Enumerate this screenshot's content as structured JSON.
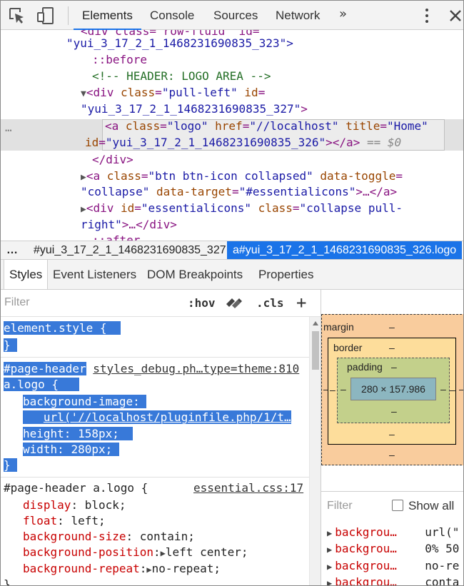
{
  "toolbar": {
    "tabs": [
      {
        "label": "Elements"
      },
      {
        "label": "Console"
      },
      {
        "label": "Sources"
      },
      {
        "label": "Network"
      }
    ],
    "more_label": "»",
    "icons": [
      "inspect-cursor-icon",
      "device-toggle-icon",
      "kebab-menu-icon",
      "close-icon"
    ]
  },
  "dom": {
    "lines": [
      {
        "t1": "<div class=\"row-fluid\" id="
      },
      {
        "t1": "\"yui_3_17_2_1_1468231690835_323\">"
      },
      {
        "t1": "::before"
      },
      {
        "t1": "<!-- HEADER: LOGO AREA -->"
      },
      {
        "tag": "<div",
        "an1": "class",
        "av1": "\"pull-left\"",
        "an2": "id",
        "eq": "="
      },
      {
        "t1": "\"yui_3_17_2_1_1468231690835_327\"",
        "close": ">"
      },
      {
        "tag": "<a",
        "an1": "class",
        "av1": "\"logo\"",
        "an2": "href",
        "av2": "\"//localhost\"",
        "an3": "title",
        "av3": "\"Home\""
      },
      {
        "an1": "id",
        "av1": "\"yui_3_17_2_1_1468231690835_326\"",
        "close": "></a>",
        "eq0": "== $0"
      },
      {
        "t1": "</div>"
      },
      {
        "tag": "<a",
        "an1": "class",
        "av1": "\"btn btn-icon collapsed\"",
        "an2": "data-toggle"
      },
      {
        "av1": "\"collapse\"",
        "an1": "data-target",
        "av2": "\"#essentialicons\"",
        "close": ">…</a>"
      },
      {
        "tag": "<div",
        "an1": "id",
        "av1": "\"essentialicons\"",
        "an2": "class",
        "av2": "\"collapse pull-"
      },
      {
        "av1": "right\"",
        "close": ">…</div>"
      },
      {
        "t1": "::after"
      }
    ],
    "ellipsis": "…"
  },
  "breadcrumbs": {
    "dots": "…",
    "items": [
      "#yui_3_17_2_1_1468231690835_327",
      "a#yui_3_17_2_1_1468231690835_326.logo"
    ]
  },
  "subtabs": [
    "Styles",
    "Event Listeners",
    "DOM Breakpoints",
    "Properties"
  ],
  "styles": {
    "filter_placeholder": "Filter",
    "hov": ":hov",
    "cls": ".cls",
    "plus": "+",
    "rule1": {
      "selector": "element.style {",
      "close": "}"
    },
    "rule2": {
      "selector1": "#page-header",
      "source": "styles_debug.ph…type=theme:810",
      "selector2": "a.logo {",
      "props": [
        {
          "name": "background-image",
          "value": ""
        },
        {
          "name": "",
          "value": "url('//localhost/pluginfile.php/1/t…"
        },
        {
          "name": "height",
          "value": "158px;"
        },
        {
          "name": "width",
          "value": "280px;"
        }
      ],
      "close": "}"
    },
    "rule3": {
      "selector": "#page-header a.logo {",
      "source": "essential.css:17",
      "props": [
        {
          "name": "display",
          "value": "block;"
        },
        {
          "name": "float",
          "value": "left;"
        },
        {
          "name": "background-size",
          "value": "contain;"
        },
        {
          "name": "background-position",
          "value": "left center;"
        },
        {
          "name": "background-repeat",
          "value": "no-repeat;"
        }
      ],
      "close": "}"
    }
  },
  "boxmodel": {
    "margin_label": "margin",
    "border_label": "border",
    "padding_label": "padding",
    "dash": "–",
    "content": "280 × 157.986"
  },
  "computed": {
    "filter_placeholder": "Filter",
    "show_all": "Show all",
    "rows": [
      {
        "name": "backgrou…",
        "value": "url(\""
      },
      {
        "name": "backgrou…",
        "value": "0% 50"
      },
      {
        "name": "backgrou…",
        "value": "no-re"
      },
      {
        "name": "backgrou…",
        "value": "conta"
      }
    ]
  },
  "colors": {
    "accent": "#1a73e8",
    "selection": "#3879d9",
    "prop_name": "#c80000",
    "tag": "#881280"
  }
}
